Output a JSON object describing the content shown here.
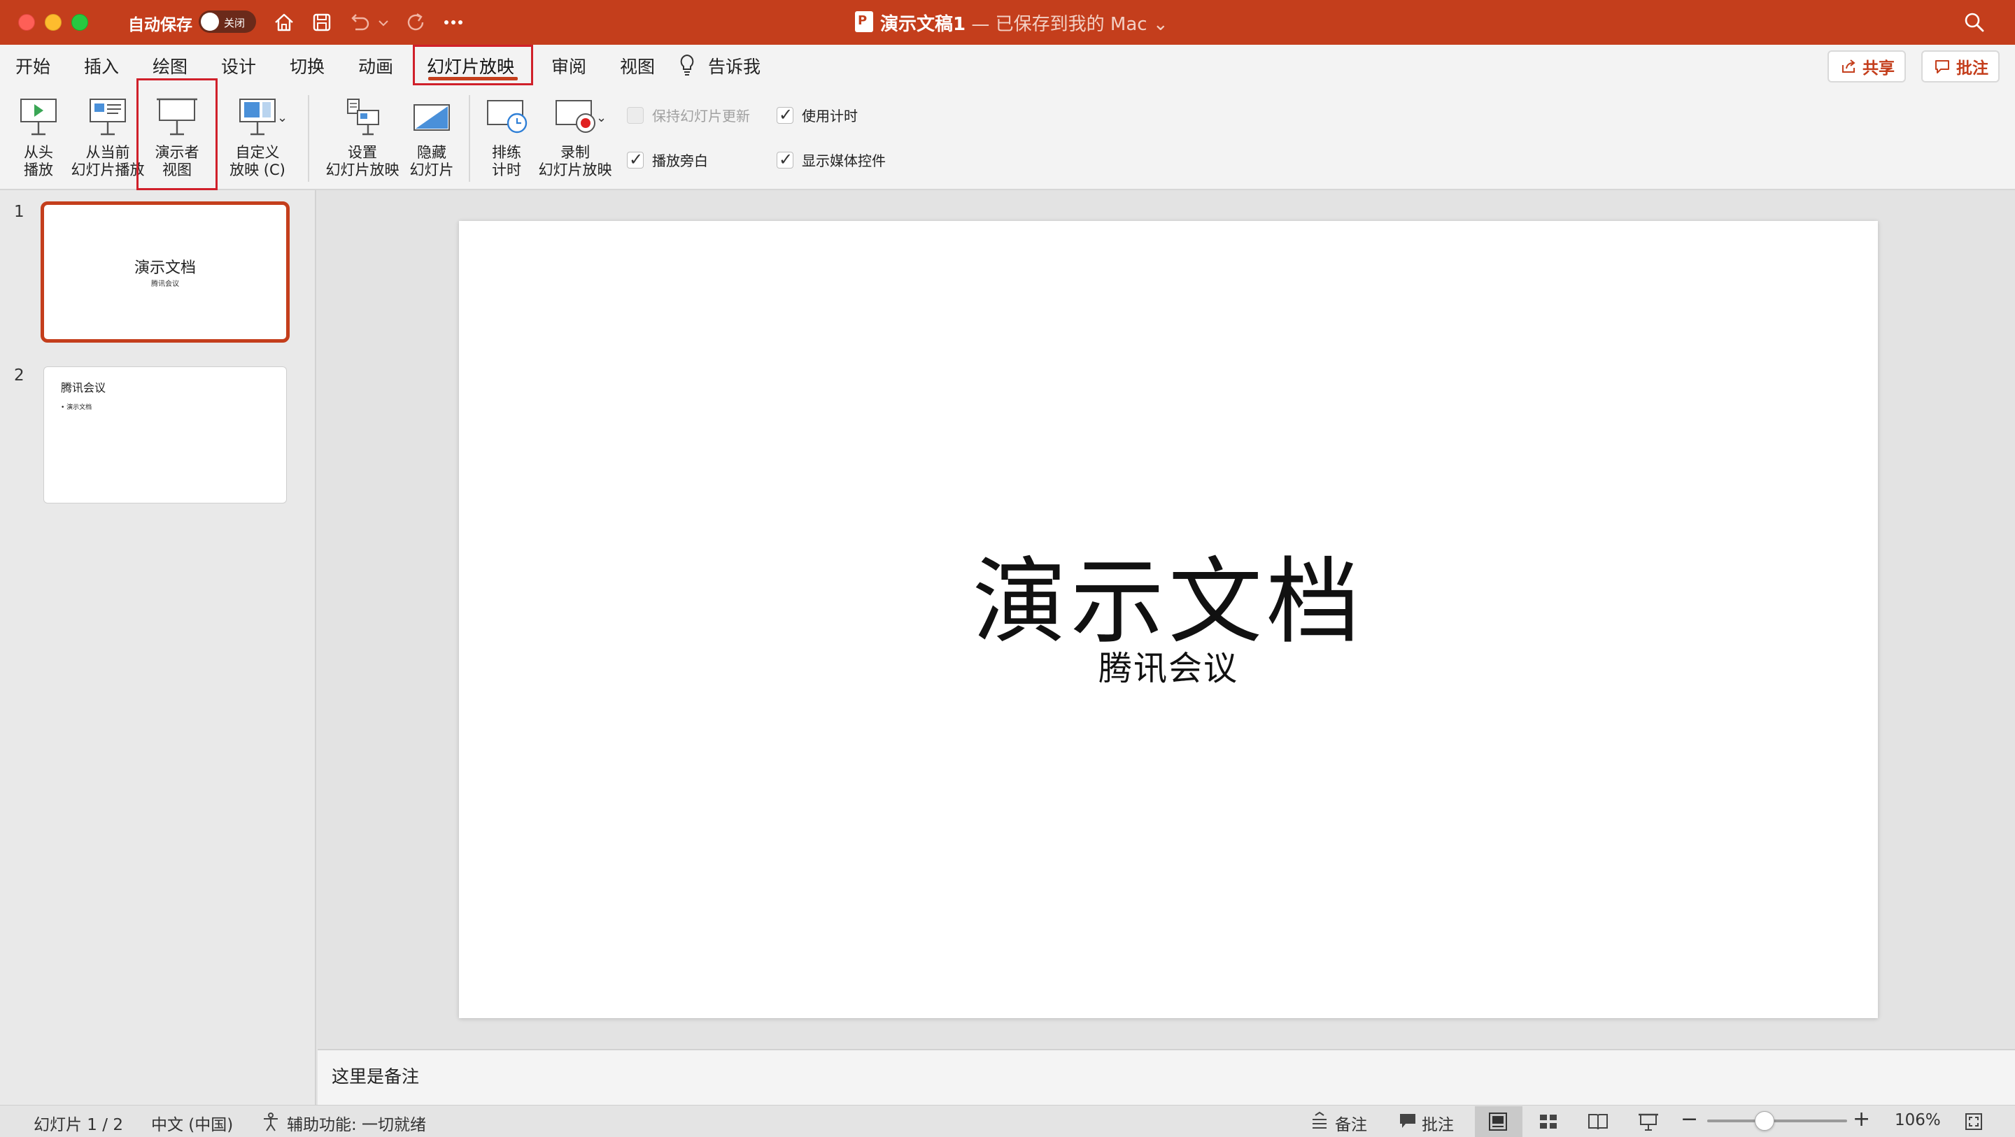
{
  "titlebar": {
    "autosave_label": "自动保存",
    "autosave_state": "关闭",
    "doc_name": "演示文稿1",
    "saved_status": " — 已保存到我的 Mac",
    "bg_color": "#c43e1c"
  },
  "menu": {
    "tabs": [
      "开始",
      "插入",
      "绘图",
      "设计",
      "切换",
      "动画",
      "幻灯片放映",
      "审阅",
      "视图"
    ],
    "tell_me": "告诉我",
    "share": "共享",
    "comments": "批注",
    "active_tab": "幻灯片放映"
  },
  "ribbon": {
    "from_beginning": [
      "从头",
      "播放"
    ],
    "from_current": [
      "从当前",
      "幻灯片播放"
    ],
    "presenter_view": [
      "演示者",
      "视图"
    ],
    "custom_show": [
      "自定义",
      "放映 (C)"
    ],
    "setup_show": [
      "设置",
      "幻灯片放映"
    ],
    "hide_slide": [
      "隐藏",
      "幻灯片"
    ],
    "rehearse": [
      "排练",
      "计时"
    ],
    "record": [
      "录制",
      "幻灯片放映"
    ],
    "keep_updated": "保持幻灯片更新",
    "play_narrations": "播放旁白",
    "use_timings": "使用计时",
    "show_media_controls": "显示媒体控件"
  },
  "slides": [
    {
      "number": "1",
      "title": "演示文档",
      "subtitle": "腾讯会议"
    },
    {
      "number": "2",
      "title": "腾讯会议",
      "bullet": "• 演示文档"
    }
  ],
  "current_slide": {
    "title": "演示文档",
    "subtitle": "腾讯会议"
  },
  "notes": "这里是备注",
  "status": {
    "slide_counter": "幻灯片 1 / 2",
    "language": "中文 (中国)",
    "accessibility": "辅助功能: 一切就绪",
    "notes_btn": "备注",
    "comments_btn": "批注",
    "zoom": "106%",
    "zoom_fraction": 0.41
  }
}
